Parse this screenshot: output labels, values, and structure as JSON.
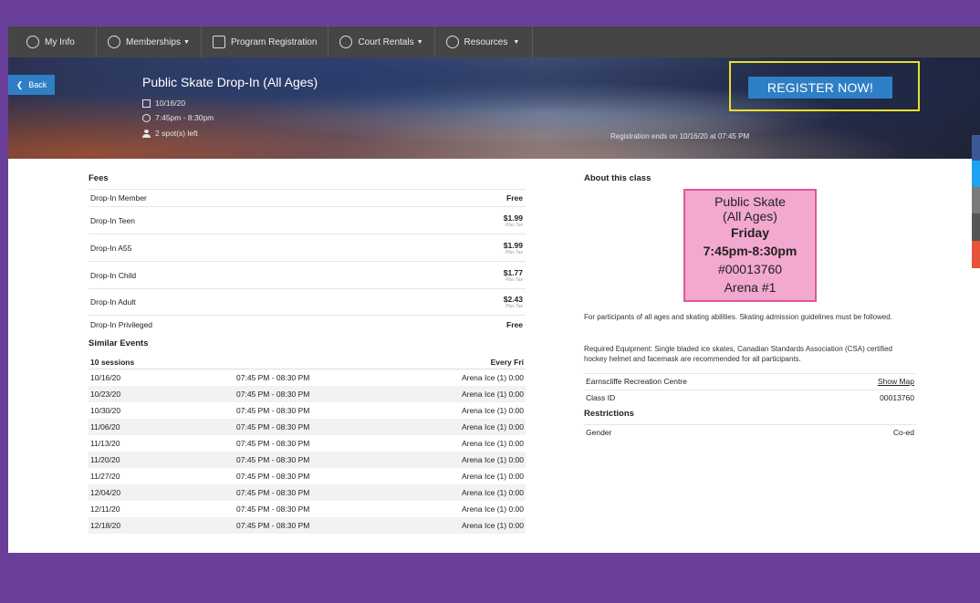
{
  "nav": {
    "my_info": "My Info",
    "memberships": "Memberships",
    "program_registration": "Program Registration",
    "court_rentals": "Court Rentals",
    "resources": "Resources"
  },
  "hero": {
    "back": "Back",
    "title": "Public Skate Drop-In (All Ages)",
    "date": "10/16/20",
    "time": "7:45pm - 8:30pm",
    "spots": "2 spot(s) left",
    "register": "REGISTER NOW!",
    "registration_ends": "Registration ends on 10/16/20 at 07:45 PM"
  },
  "fees": {
    "heading": "Fees",
    "rows": [
      {
        "name": "Drop-In Member",
        "price": "Free",
        "note": ""
      },
      {
        "name": "Drop-In Teen",
        "price": "$1.99",
        "note": "Plus Tax"
      },
      {
        "name": "Drop-In A55",
        "price": "$1.99",
        "note": "Plus Tax"
      },
      {
        "name": "Drop-In Child",
        "price": "$1.77",
        "note": "Plus Tax"
      },
      {
        "name": "Drop-In Adult",
        "price": "$2.43",
        "note": "Plus Tax"
      },
      {
        "name": "Drop-In Privileged",
        "price": "Free",
        "note": ""
      }
    ]
  },
  "similar": {
    "heading": "Similar Events",
    "sessions": "10 sessions",
    "frequency": "Every Fri",
    "rows": [
      {
        "date": "10/16/20",
        "time": "07:45 PM - 08:30 PM",
        "venue": "Arena Ice (1) 0:00"
      },
      {
        "date": "10/23/20",
        "time": "07:45 PM - 08:30 PM",
        "venue": "Arena Ice (1) 0:00"
      },
      {
        "date": "10/30/20",
        "time": "07:45 PM - 08:30 PM",
        "venue": "Arena Ice (1) 0:00"
      },
      {
        "date": "11/06/20",
        "time": "07:45 PM - 08:30 PM",
        "venue": "Arena Ice (1) 0:00"
      },
      {
        "date": "11/13/20",
        "time": "07:45 PM - 08:30 PM",
        "venue": "Arena Ice (1) 0:00"
      },
      {
        "date": "11/20/20",
        "time": "07:45 PM - 08:30 PM",
        "venue": "Arena Ice (1) 0:00"
      },
      {
        "date": "11/27/20",
        "time": "07:45 PM - 08:30 PM",
        "venue": "Arena Ice (1) 0:00"
      },
      {
        "date": "12/04/20",
        "time": "07:45 PM - 08:30 PM",
        "venue": "Arena Ice (1) 0:00"
      },
      {
        "date": "12/11/20",
        "time": "07:45 PM - 08:30 PM",
        "venue": "Arena Ice (1) 0:00"
      },
      {
        "date": "12/18/20",
        "time": "07:45 PM - 08:30 PM",
        "venue": "Arena Ice (1) 0:00"
      }
    ]
  },
  "about": {
    "heading": "About this class",
    "poster": {
      "line1": "Public Skate",
      "line2": "(All Ages)",
      "line3": "Friday",
      "line4": "7:45pm-8:30pm",
      "line5": "#00013760",
      "line6": "Arena #1"
    },
    "description": "For participants of all ages and skating abilities.  Skating admission guidelines must be followed.",
    "equipment": "Required Equipment: Single bladed ice skates, Canadian Standards Association (CSA) certified hockey helmet and facemask are recommended for all participants.",
    "location": "Earnscliffe Recreation Centre",
    "show_map": "Show Map",
    "class_id_label": "Class ID",
    "class_id": "00013760",
    "restrictions_heading": "Restrictions",
    "gender_label": "Gender",
    "gender": "Co-ed"
  },
  "colors": {
    "page_bg": "#6a3f9a",
    "nav_bg": "#454545",
    "accent": "#2f7fc6",
    "highlight": "#e8e02a",
    "poster_bg": "#f3a8cf"
  }
}
